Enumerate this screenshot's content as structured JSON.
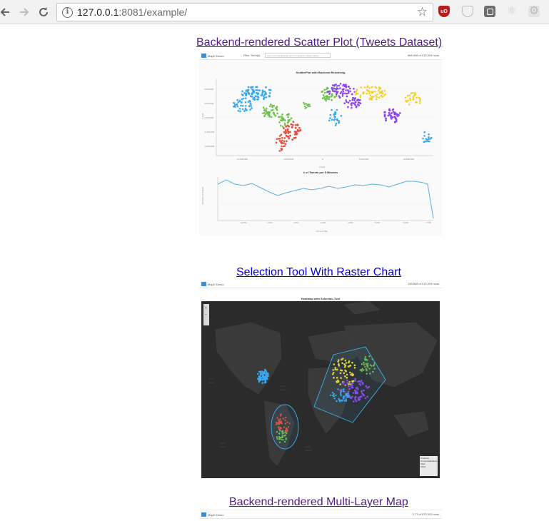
{
  "browser": {
    "url_host": "127.0.0.1",
    "url_rest": ":8081/example/",
    "icons": [
      "back-arrow-icon",
      "forward-arrow-icon",
      "reload-icon",
      "info-icon",
      "bookmark-star-icon",
      "ublock-origin-icon",
      "shield-extension-icon",
      "square-extension-icon",
      "react-devtools-icon",
      "gear-extension-icon"
    ]
  },
  "examples": [
    {
      "title": "Backend-rendered Scatter Plot (Tweets Dataset) ",
      "thumbnail": {
        "logo": "MapD Demo",
        "filter_label": "Filter Term(s)",
        "filter_hint": "use a comma between terms to search multiple values",
        "count": "968,006 of 573,003 rows",
        "chart1_title": "ScatterPlot with Backend Rendering",
        "chart1_xlabel": "X Axis",
        "chart1_ylabel": "Y Axis",
        "chart2_title": "# of Tweets per 5 Minutes",
        "chart2_ylabel": "Number of Tweets",
        "chart2_xlabel": "Time of Day"
      }
    },
    {
      "title": "Selection Tool With Raster Chart ",
      "thumbnail": {
        "logo": "MapD Demo",
        "count": "139,845 of 573,003 rows",
        "map_title": "Heatmap with Selection Tool",
        "legend_title": "Producto",
        "legend_items": [
          "Comercializadora",
          "Tags",
          "Other"
        ]
      }
    },
    {
      "title": "Backend-rendered Multi-Layer Map ",
      "thumbnail": {
        "logo": "MapD Demo",
        "count": "2,77 of 573,003 rows"
      }
    }
  ],
  "colors": {
    "visited_link": "#551a8b",
    "unvisited_link": "#0000ee",
    "point_blue": "#3aa8f0",
    "point_green": "#6cc24a",
    "point_red": "#e84d3d",
    "point_purple": "#8e44ec",
    "point_yellow": "#f1d130",
    "map_dark": "#2b2b2b",
    "selection_stroke": "#3ab0e6"
  }
}
